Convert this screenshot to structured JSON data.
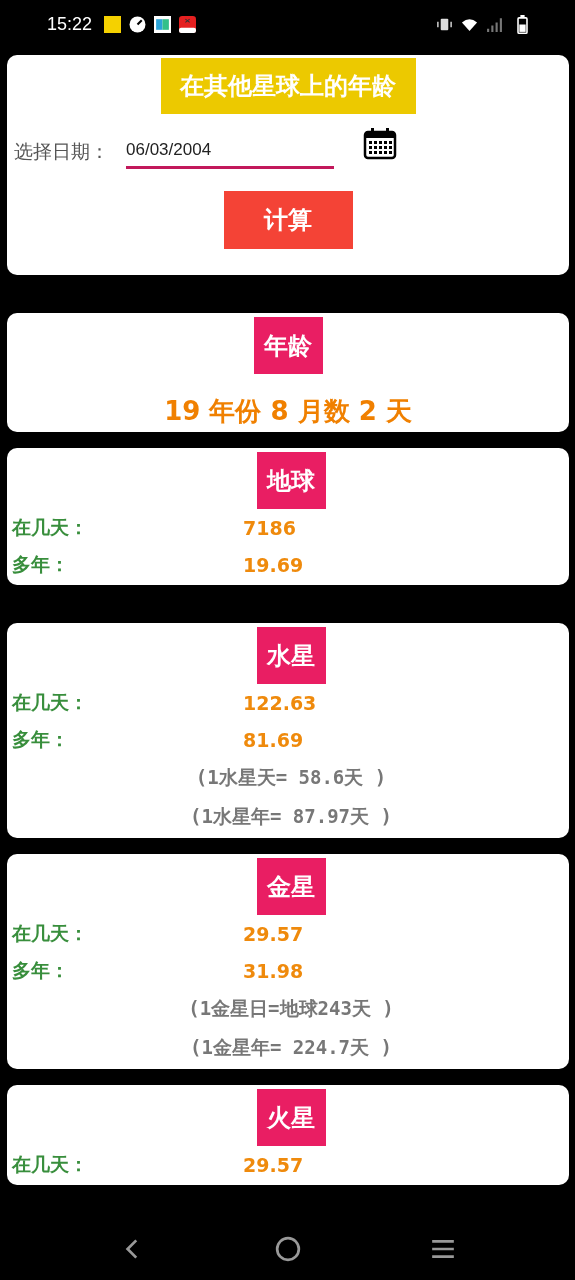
{
  "status_bar": {
    "time": "15:22"
  },
  "form": {
    "title": "在其他星球上的年龄",
    "date_label": "选择日期：",
    "date_value": "06/03/2004",
    "button": "计算"
  },
  "age": {
    "title": "年龄",
    "result": "19 年份 8 月数 2 天"
  },
  "planets": [
    {
      "name": "地球",
      "rows": [
        {
          "label": "在几天：",
          "value": "7186"
        },
        {
          "label": "多年：",
          "value": "19.69"
        }
      ]
    },
    {
      "name": "水星",
      "rows": [
        {
          "label": "在几天：",
          "value": "122.63"
        },
        {
          "label": "多年：",
          "value": "81.69"
        }
      ],
      "notes": [
        "(1水星天= 58.6天 )",
        "(1水星年= 87.97天 )"
      ]
    },
    {
      "name": "金星",
      "rows": [
        {
          "label": "在几天：",
          "value": "29.57"
        },
        {
          "label": "多年：",
          "value": "31.98"
        }
      ],
      "notes": [
        "(1金星日=地球243天 )",
        "(1金星年= 224.7天 )"
      ]
    },
    {
      "name": "火星",
      "rows": [
        {
          "label": "在几天：",
          "value": "29.57"
        }
      ]
    }
  ]
}
